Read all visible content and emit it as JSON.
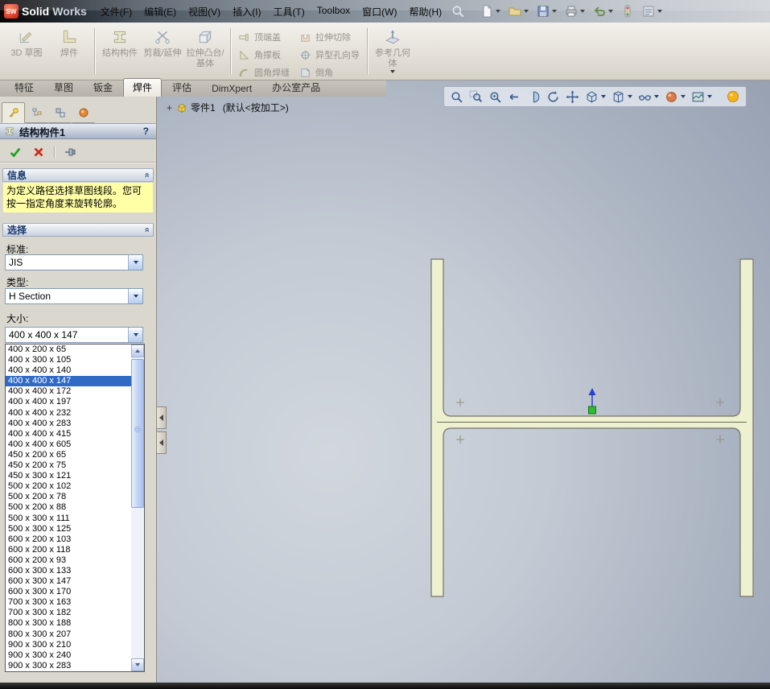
{
  "titlebar": {
    "logo_badge": "SW",
    "logo_text_solid": "Solid",
    "logo_text_works": "Works",
    "menus": [
      {
        "label": "文件(F)",
        "key": "file"
      },
      {
        "label": "编辑(E)",
        "key": "edit"
      },
      {
        "label": "视图(V)",
        "key": "view"
      },
      {
        "label": "插入(I)",
        "key": "insert"
      },
      {
        "label": "工具(T)",
        "key": "tools"
      },
      {
        "label": "Toolbox",
        "key": "toolbox"
      },
      {
        "label": "窗口(W)",
        "key": "window"
      },
      {
        "label": "帮助(H)",
        "key": "help"
      }
    ],
    "quick_tools": [
      {
        "name": "new-document",
        "icon": "new-doc",
        "caret": true
      },
      {
        "name": "open-document",
        "icon": "open-folder",
        "caret": true
      },
      {
        "name": "save",
        "icon": "save",
        "caret": true
      },
      {
        "name": "print",
        "icon": "print",
        "caret": true
      },
      {
        "name": "undo",
        "icon": "undo",
        "caret": true
      },
      {
        "name": "rebuild",
        "icon": "rebuild",
        "caret": false
      },
      {
        "name": "options",
        "icon": "options",
        "caret": true
      }
    ]
  },
  "ribbon": {
    "groups": [
      {
        "items": [
          {
            "label": "3D 草图",
            "icon": "sketch3d"
          },
          {
            "label": "焊件",
            "icon": "weldment"
          }
        ]
      },
      {
        "items": [
          {
            "label": "结构构件",
            "icon": "structural-member"
          },
          {
            "label": "剪裁/延伸",
            "icon": "trim-extend"
          },
          {
            "label": "拉伸凸台/基体",
            "icon": "extrude-boss"
          }
        ]
      },
      {
        "cols": [
          [
            {
              "label": "顶端盖",
              "icon": "end-cap"
            },
            {
              "label": "角撑板",
              "icon": "gusset"
            },
            {
              "label": "圆角焊缝",
              "icon": "fillet-bead"
            }
          ],
          [
            {
              "label": "拉伸切除",
              "icon": "extruded-cut"
            },
            {
              "label": "异型孔向导",
              "icon": "hole-wizard"
            },
            {
              "label": "倒角",
              "icon": "chamfer"
            }
          ]
        ]
      },
      {
        "items": [
          {
            "label": "参考几何体",
            "icon": "reference-geometry",
            "caret": true
          }
        ]
      }
    ]
  },
  "tabs": {
    "active_index": 3,
    "items": [
      {
        "label": "特征",
        "key": "features"
      },
      {
        "label": "草图",
        "key": "sketch"
      },
      {
        "label": "钣金",
        "key": "sheet-metal"
      },
      {
        "label": "焊件",
        "key": "weldments"
      },
      {
        "label": "评估",
        "key": "evaluate"
      },
      {
        "label": "DimXpert",
        "key": "dimxpert"
      },
      {
        "label": "办公室产品",
        "key": "office-products"
      }
    ]
  },
  "viewport": {
    "tree_expand": "+",
    "tree_item": "零件1",
    "tree_config": "(默认<按加工>)",
    "tools": [
      {
        "name": "zoom-to-fit",
        "icon": "zoom-fit",
        "caret": false
      },
      {
        "name": "zoom-to-area",
        "icon": "zoom-area",
        "caret": false
      },
      {
        "name": "zoom-in-out",
        "icon": "zoom-inout",
        "caret": false
      },
      {
        "name": "previous-view",
        "icon": "previous-view",
        "caret": false
      },
      {
        "name": "section-view",
        "icon": "section-view",
        "caret": false
      },
      {
        "name": "rotate-view",
        "icon": "rotate-view",
        "caret": false
      },
      {
        "name": "pan",
        "icon": "pan",
        "caret": false
      },
      {
        "name": "view-orientation",
        "icon": "view-orientation",
        "caret": true
      },
      {
        "name": "display-style",
        "icon": "display-style",
        "caret": true
      },
      {
        "name": "hide-show-items",
        "icon": "hide-show",
        "caret": true
      },
      {
        "name": "appearances",
        "icon": "appearances",
        "caret": true
      },
      {
        "name": "scene",
        "icon": "scene",
        "caret": true
      },
      {
        "name": "view-settings",
        "icon": "light-bulb",
        "caret": false
      }
    ]
  },
  "property_manager": {
    "panel_tabs": [
      {
        "name": "propertymanager-tab",
        "icon": "pm-key",
        "active": true
      },
      {
        "name": "featuremanager-tab",
        "icon": "feature-tree",
        "active": false
      },
      {
        "name": "configurationmanager-tab",
        "icon": "config-blocks",
        "active": false
      },
      {
        "name": "displaymanager-tab",
        "icon": "display-ball",
        "active": false
      }
    ],
    "title": "结构构件1",
    "help_label": "?",
    "info": {
      "header": "信息",
      "message": "为定义路径选择草图线段。您可按一指定角度来旋转轮廓。"
    },
    "selection": {
      "header": "选择",
      "standard_label": "标准:",
      "standard_value": "JIS",
      "type_label": "类型:",
      "type_value": "H Section",
      "size_label": "大小:",
      "size_value": "400 x 400 x 147",
      "selected_option": "400 x 400 x 147",
      "size_options": [
        "400 x 200 x 65",
        "400 x 300 x 105",
        "400 x 400 x 140",
        "400 x 400 x 147",
        "400 x 400 x 172",
        "400 x 400 x 197",
        "400 x 400 x 232",
        "400 x 400 x 283",
        "400 x 400 x 415",
        "400 x 400 x 605",
        "450 x 200 x 65",
        "450 x 200 x 75",
        "450 x 300 x 121",
        "500 x 200 x 102",
        "500 x 200 x 78",
        "500 x 200 x 88",
        "500 x 300 x 111",
        "500 x 300 x 125",
        "600 x 200 x 103",
        "600 x 200 x 118",
        "600 x 200 x 93",
        "600 x 300 x 133",
        "600 x 300 x 147",
        "600 x 300 x 170",
        "700 x 300 x 163",
        "700 x 300 x 182",
        "800 x 300 x 188",
        "800 x 300 x 207",
        "900 x 300 x 210",
        "900 x 300 x 240",
        "900 x 300 x 283"
      ]
    }
  },
  "colors": {
    "selection_blue": "#316ac5",
    "message_yellow": "#ffffa6",
    "beam_fill": "#eef1cf",
    "viewport_top": "#97a1b2",
    "viewport_light": "#d2d7de"
  }
}
